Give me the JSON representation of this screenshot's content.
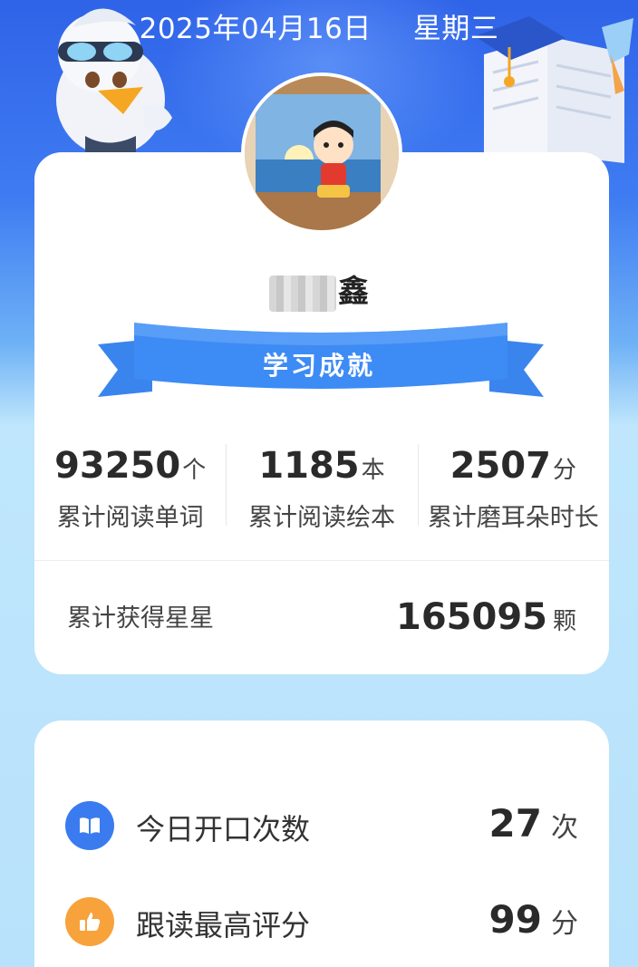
{
  "header": {
    "date": "2025年04月16日",
    "weekday": "星期三"
  },
  "profile": {
    "name_visible_char": "鑫",
    "badge": "学习成就"
  },
  "stats": [
    {
      "value": "93250",
      "unit": "个",
      "label": "累计阅读单词"
    },
    {
      "value": "1185",
      "unit": "本",
      "label": "累计阅读绘本"
    },
    {
      "value": "2507",
      "unit": "分",
      "label": "累计磨耳朵时长"
    }
  ],
  "stars": {
    "label": "累计获得星星",
    "value": "165095",
    "unit": "颗"
  },
  "daily": [
    {
      "icon": "book-icon",
      "label": "今日开口次数",
      "value": "27",
      "unit": "次"
    },
    {
      "icon": "thumbs-up-icon",
      "label": "跟读最高评分",
      "value": "99",
      "unit": "分"
    }
  ],
  "colors": {
    "primary_blue": "#3a7bf0",
    "accent_orange": "#f7a23a",
    "card_bg": "#ffffff"
  }
}
